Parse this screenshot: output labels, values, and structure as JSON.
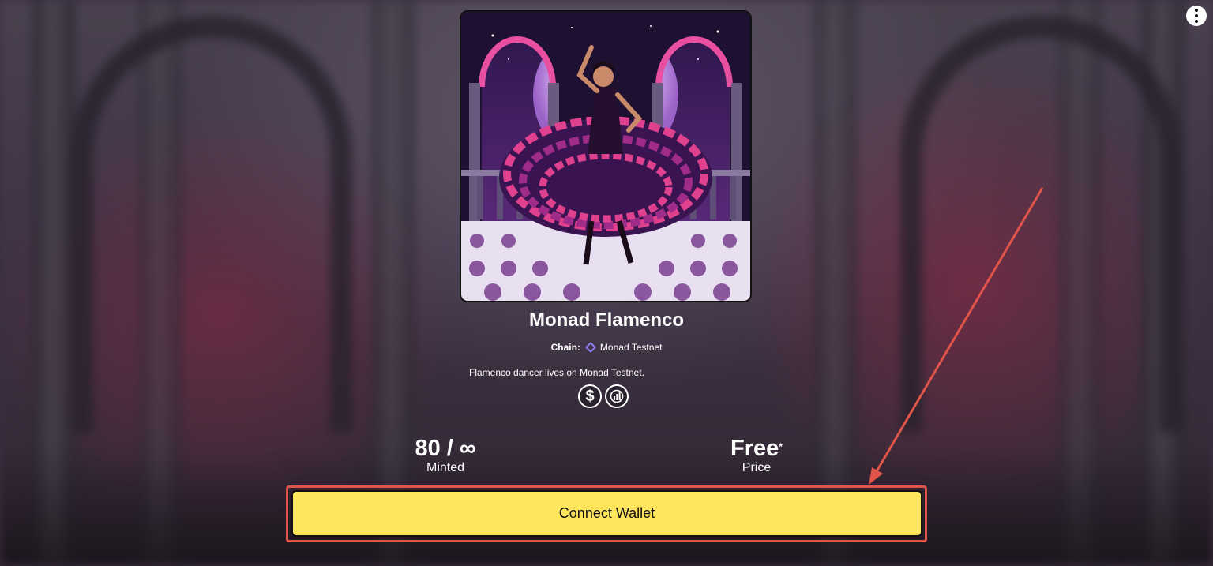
{
  "collection": {
    "title": "Monad Flamenco",
    "chain_label": "Chain:",
    "chain_name": "Monad Testnet",
    "description": "Flamenco dancer lives on Monad Testnet."
  },
  "stats": {
    "minted_value": "80 / ∞",
    "minted_label": "Minted",
    "price_value": "Free",
    "price_marker": "*",
    "price_label": "Price"
  },
  "actions": {
    "connect_wallet_label": "Connect Wallet",
    "menu_icon": "more-vertical-icon"
  },
  "icons": {
    "dollar": "$",
    "chart": "chart-icon"
  },
  "colors": {
    "button": "#ffe55c",
    "annotation": "#e0554a",
    "chain_accent": "#8b7cf6"
  }
}
